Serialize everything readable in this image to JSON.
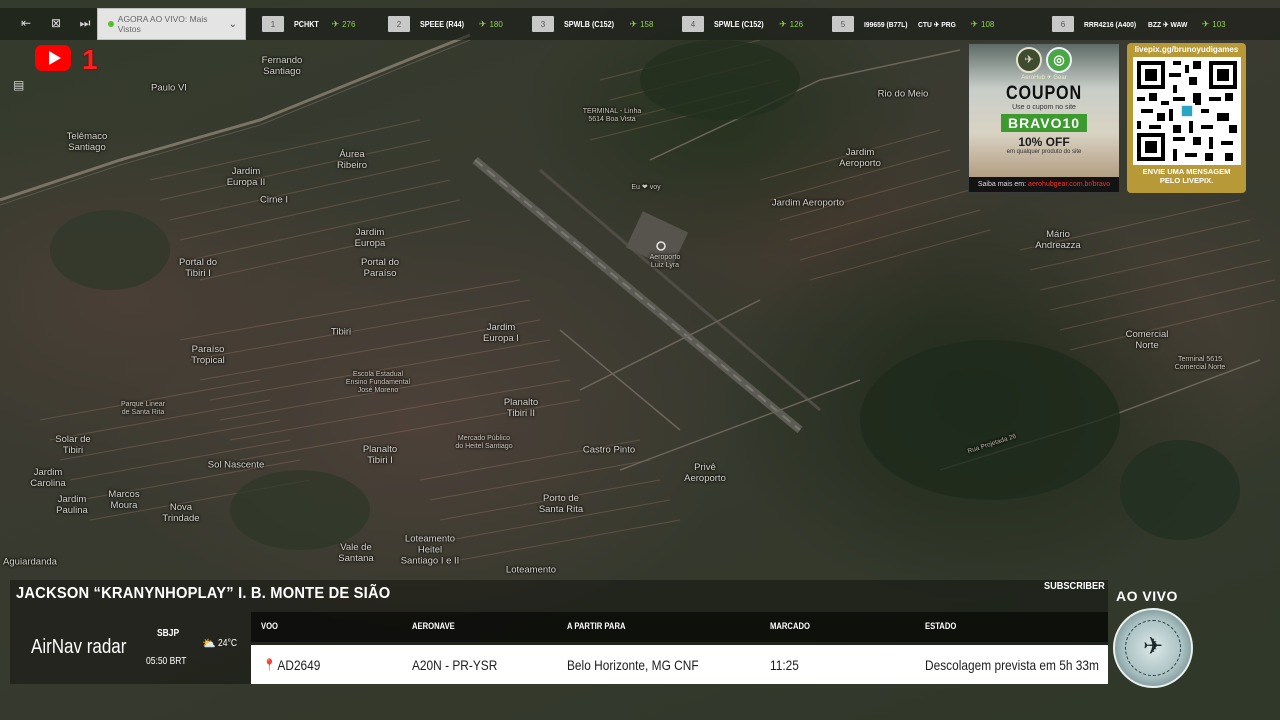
{
  "topbar": {
    "live_label": "AGORA AO VIVO: Mais Vistos",
    "flights": [
      {
        "num": "1",
        "callsign": "PCHKT",
        "count": "276"
      },
      {
        "num": "2",
        "callsign": "SPEEE (R44)",
        "count": "180"
      },
      {
        "num": "3",
        "callsign": "SPWLB (C152)",
        "count": "158"
      },
      {
        "num": "4",
        "callsign": "SPWLE (C152)",
        "count": "126"
      },
      {
        "num": "5",
        "callsign": "I99659 (B77L)",
        "route": "CTU ✈ PRG",
        "count": "108"
      },
      {
        "num": "6",
        "callsign": "RRR4216 (A400)",
        "route": "BZZ ✈ WAW",
        "count": "103"
      }
    ]
  },
  "youtube": {
    "badge": "1"
  },
  "map_labels": {
    "fernando": "Fernando\nSantiago",
    "paulo": "Paulo VI",
    "telemaco": "Telêmaco\nSantiago",
    "aurea": "Áurea\nRibeiro",
    "jeuropa2": "Jardim\nEuropa II",
    "cirne": "Cirne I",
    "jeuropa": "Jardim\nEuropa",
    "ptibiri": "Portal do\nTibiri I",
    "pparaiso": "Portal do\nParaíso",
    "tibiri": "Tibiri",
    "ptropical": "Paraíso\nTropical",
    "jeuropa1": "Jardim\nEuropa I",
    "planalto2": "Planalto\nTibiri II",
    "planalto1": "Planalto\nTibiri I",
    "solar": "Solar de\nTibiri",
    "jcarolina": "Jardim\nCarolina",
    "jpaulina": "Jardim\nPaulina",
    "marcos": "Marcos\nMoura",
    "novatrindade": "Nova\nTrindade",
    "solnascente": "Sol Nascente",
    "castropinto": "Castro Pinto",
    "prive": "Privê\nAeroporto",
    "portosr": "Porto de\nSanta Rita",
    "vale": "Vale de\nSantana",
    "loteamento": "Loteamento\nHeitel\nSantiago I e II",
    "loteamento2": "Loteamento",
    "aguiar": "Aguiardanda",
    "riomeio": "Rio do Meio",
    "jaeroporto": "Jardim\nAeroporto",
    "jaeroporto2": "Jardim Aeroporto",
    "mandreazza": "Mário\nAndreazza",
    "comercial": "Comercial\nNorte",
    "terminal": "TERMINAL - Linha\n5614 Boa Vista",
    "terminal2": "Terminal 5615\nComercial Norte",
    "aeroporto": "Aeroporto\nLuiz Lyra",
    "euvoy": "Eu ❤ voy",
    "rua": "Rua Projetada 26",
    "mercado": "Mercado Público\ndo Heitel Santiago",
    "escola": "Escola Estadual\nEnsino Fundamental\nJosé Moreno",
    "parque": "Parque Linear\nde Santa Rita"
  },
  "coupon": {
    "brand": "AeroHub ✈ Gear",
    "title": "COUPON",
    "sub": "Use o cupom no site",
    "code": "BRAVO10",
    "off": "10% OFF",
    "desc": "em qualquer produto do site",
    "foot_label": "Saiba mais em:",
    "foot_url": "aerohubgear.com.br/bravo"
  },
  "qr": {
    "link": "livepix.gg/brunoyudigames",
    "cta": "ENVIE UMA MENSAGEM\nPELO LIVEPIX."
  },
  "panel": {
    "pilot": "JACKSON “KRANYNHOPLAY” I. B. MONTE DE SIÃO",
    "subscriber": "SUBSCRIBER",
    "live": "AO VIVO",
    "airnav_bold": "AirNav",
    "airnav_light": "radar",
    "airport_code": "SBJP",
    "airport_time": "05:50 BRT",
    "temp": "24°C",
    "headers": {
      "flight": "VOO",
      "aircraft": "AERONAVE",
      "from_to": "A PARTIR PARA",
      "scheduled": "MARCADO",
      "status": "ESTADO"
    },
    "row": {
      "flight": "AD2649",
      "aircraft": "A20N - PR-YSR",
      "from_to": "Belo Horizonte, MG CNF",
      "scheduled": "11:25",
      "status": "Descolagem prevista em 5h 33m"
    }
  },
  "colors": {
    "accent_green": "#8fd14f",
    "youtube_red": "#ff0000",
    "coupon_green": "#3d9a2f",
    "qr_gold": "#b79a37"
  }
}
